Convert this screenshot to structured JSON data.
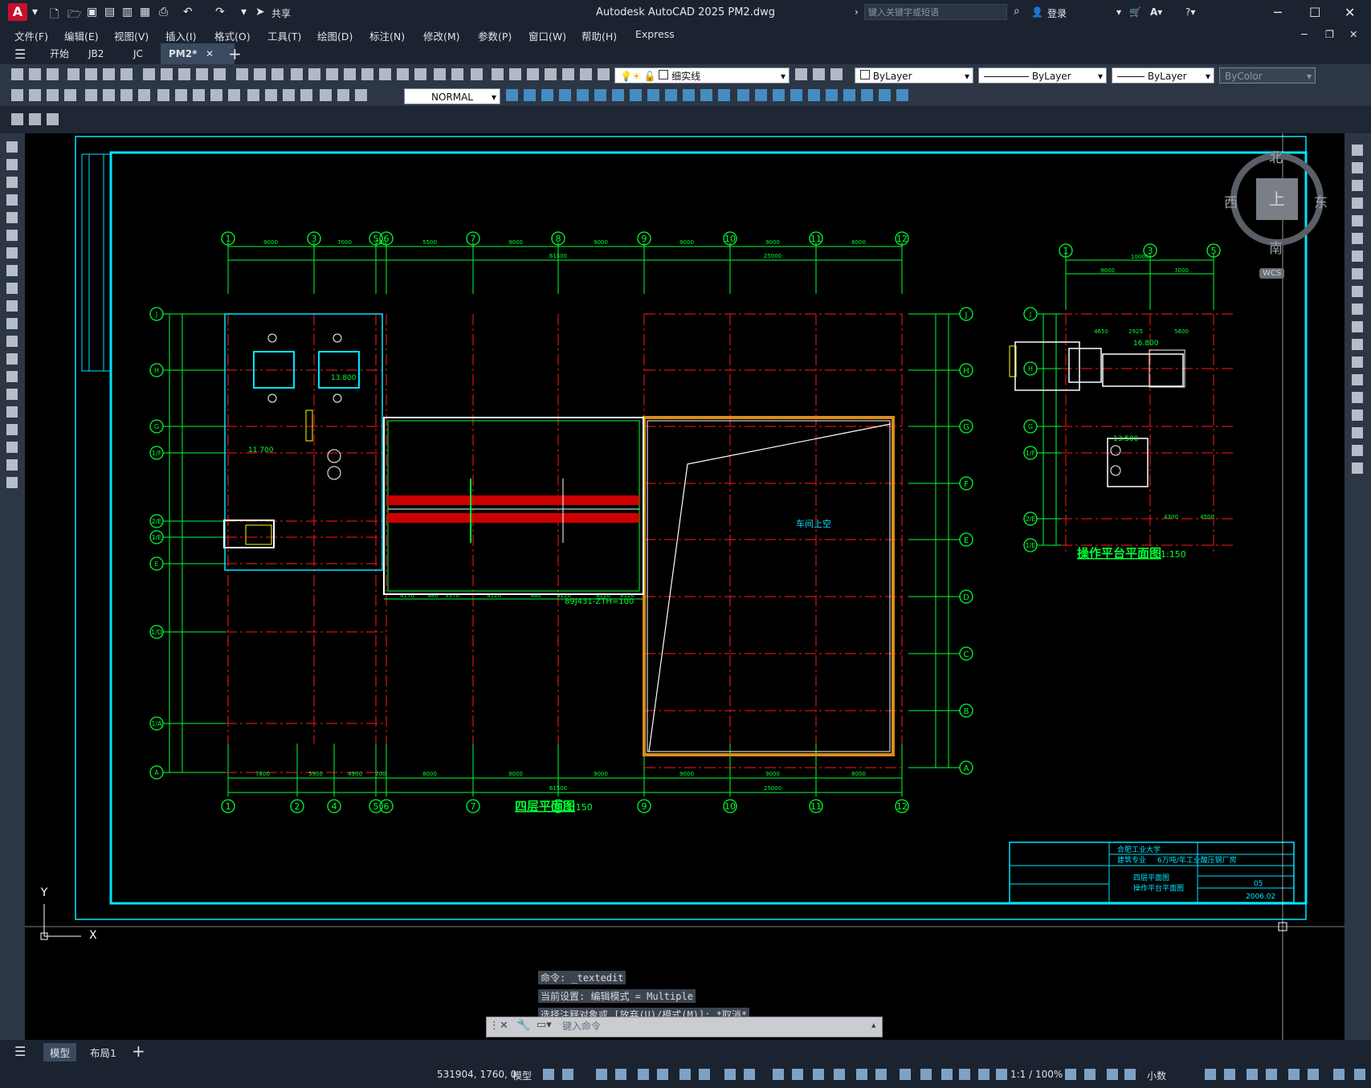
{
  "window": {
    "title": "Autodesk AutoCAD 2025    PM2.dwg",
    "app_icon": "A",
    "share_label": "共享",
    "search_placeholder": "键入关键字或短语",
    "login_label": "登录"
  },
  "menu": [
    "文件(F)",
    "编辑(E)",
    "视图(V)",
    "插入(I)",
    "格式(O)",
    "工具(T)",
    "绘图(D)",
    "标注(N)",
    "修改(M)",
    "参数(P)",
    "窗口(W)",
    "帮助(H)",
    "Express"
  ],
  "tabs": [
    {
      "label": "开始",
      "active": false
    },
    {
      "label": "JB2",
      "active": false
    },
    {
      "label": "JC",
      "active": false
    },
    {
      "label": "PM2*",
      "active": true
    }
  ],
  "toolbar": {
    "layer_name": "细实线",
    "color": "ByLayer",
    "linetype": "ByLayer",
    "lineweight": "ByLayer",
    "plotstyle": "ByColor",
    "dimstyle": "NORMAL"
  },
  "viewcube": {
    "north": "北",
    "south": "南",
    "east": "东",
    "west": "西",
    "top": "上",
    "wcs": "WCS"
  },
  "drawing": {
    "main_title": "四层平面图",
    "main_scale": "1:150",
    "side_title": "操作平台平面图",
    "side_scale": "1:150",
    "void_label": "车间上空",
    "stair_note": "89J431-ZTH=100",
    "axes_top": [
      "1",
      "3",
      "5",
      "6",
      "7",
      "8",
      "9",
      "10",
      "11",
      "12"
    ],
    "axes_bottom": [
      "1",
      "2",
      "4",
      "5",
      "6",
      "7",
      "8",
      "9",
      "10",
      "11",
      "12"
    ],
    "axes_left": [
      "J",
      "H",
      "G",
      "1/F",
      "2/E",
      "1/E",
      "E",
      "1/D",
      "1/A",
      "A"
    ],
    "axes_right": [
      "J",
      "H",
      "G",
      "F",
      "E",
      "D",
      "C",
      "B",
      "A"
    ],
    "side_axes_top": [
      "1",
      "3",
      "5"
    ],
    "side_axes_left": [
      "J",
      "H",
      "G",
      "1/F",
      "2/E",
      "1/E"
    ],
    "dims_top": [
      "9000",
      "7000",
      "700",
      "5500",
      "9000",
      "9000",
      "9000",
      "9000",
      "8000"
    ],
    "dims_top2": [
      "61500",
      "25000"
    ],
    "dims_bottom": [
      "7800",
      "5900",
      "4900",
      "700",
      "8000",
      "9000",
      "9000",
      "9000",
      "9000",
      "8000"
    ],
    "dims_bottom2": [
      "61500",
      "25000"
    ],
    "dims_mid": [
      "4170",
      "480",
      "3370",
      "4120",
      "480",
      "4120",
      "4120",
      "4120"
    ],
    "elev_1": "11.700",
    "elev_2": "13.800",
    "elev_3": "13.500",
    "elev_4": "16.800",
    "side_dims_top": [
      "10000",
      "9000",
      "7000"
    ],
    "side_dims": [
      "4650",
      "2925",
      "5600",
      "4300",
      "4500"
    ],
    "titleblock_org": "合肥工业大学",
    "titleblock_project": "6万吨/年工业酸压钢厂房",
    "titleblock_drawing1": "四层平面图",
    "titleblock_drawing2": "操作平台平面图",
    "titleblock_label1": "建筑专业",
    "titleblock_no": "05",
    "titleblock_date": "2006.02"
  },
  "command": {
    "history": [
      "命令: _textedit",
      "当前设置: 编辑模式 = Multiple",
      "选择注释对象或 [放弃(U)/模式(M)]: *取消*"
    ],
    "placeholder": "键入命令"
  },
  "layouts": [
    {
      "label": "模型",
      "active": true
    },
    {
      "label": "布局1",
      "active": false
    }
  ],
  "status": {
    "coords": "531904, 1760, 0",
    "model": "模型",
    "scale": "1:1 / 100%",
    "units": "小数"
  },
  "colors": {
    "cyan": "#00e5ff",
    "green": "#00ff33",
    "red": "#ff1a1a",
    "yellow": "#ffff00",
    "orange": "#d98c1a",
    "white": "#ffffff"
  }
}
